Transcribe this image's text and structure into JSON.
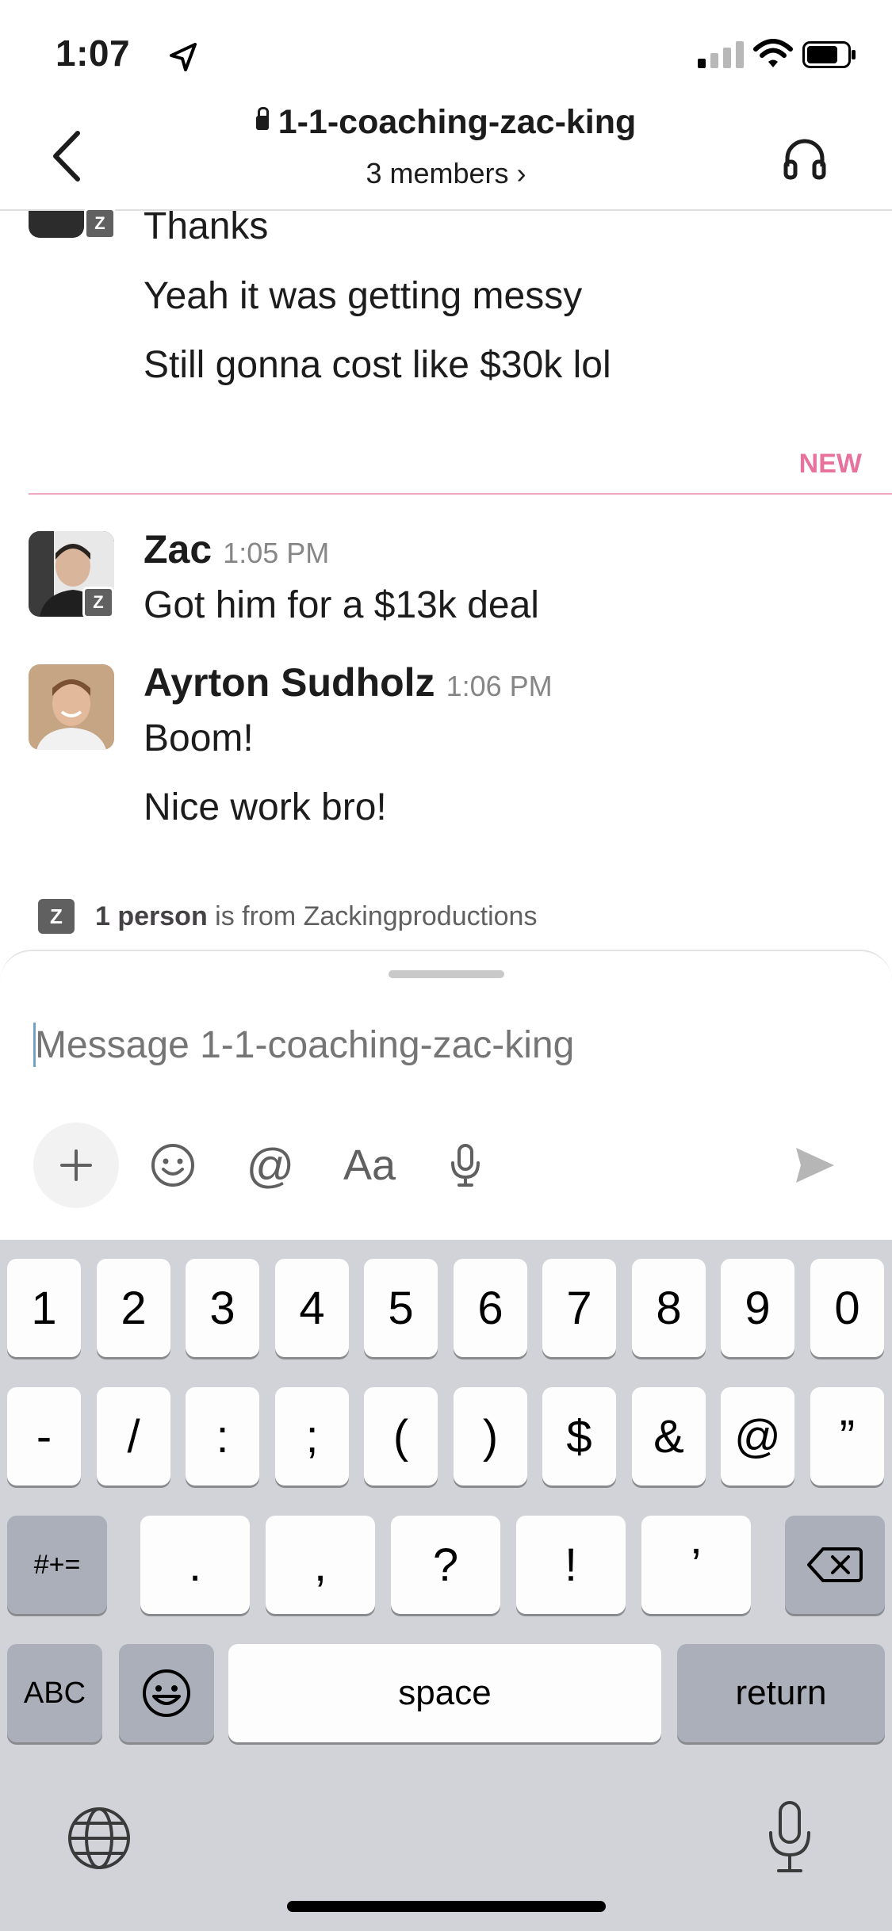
{
  "status_bar": {
    "time": "1:07"
  },
  "header": {
    "channel_name": "1-1-coaching-zac-king",
    "members": "3 members ›"
  },
  "messages": {
    "previous": [
      "Thanks",
      "Yeah it was getting messy",
      "Still gonna cost like $30k lol"
    ],
    "new_label": "NEW",
    "zac": {
      "name": "Zac",
      "time": "1:05 PM",
      "text": "Got him for a $13k deal"
    },
    "ayrton": {
      "name": "Ayrton Sudholz",
      "time": "1:06 PM",
      "lines": [
        "Boom!",
        "Nice work bro!"
      ]
    },
    "org_badge": "Z"
  },
  "external_notice": {
    "bold": "1 person",
    "rest": " is from Zackingproductions"
  },
  "composer": {
    "placeholder": "Message 1-1-coaching-zac-king",
    "format_label": "Aa"
  },
  "keyboard": {
    "row1": [
      "1",
      "2",
      "3",
      "4",
      "5",
      "6",
      "7",
      "8",
      "9",
      "0"
    ],
    "row2": [
      "-",
      "/",
      ":",
      ";",
      "(",
      ")",
      "$",
      "&",
      "@",
      "”"
    ],
    "row3": [
      ".",
      ",",
      "?",
      "!",
      "’"
    ],
    "symbols_key": "#+=",
    "abc_key": "ABC",
    "space_key": "space",
    "return_key": "return"
  },
  "colors": {
    "new_divider": "#e0457b",
    "link_blue": "#1264a3"
  }
}
